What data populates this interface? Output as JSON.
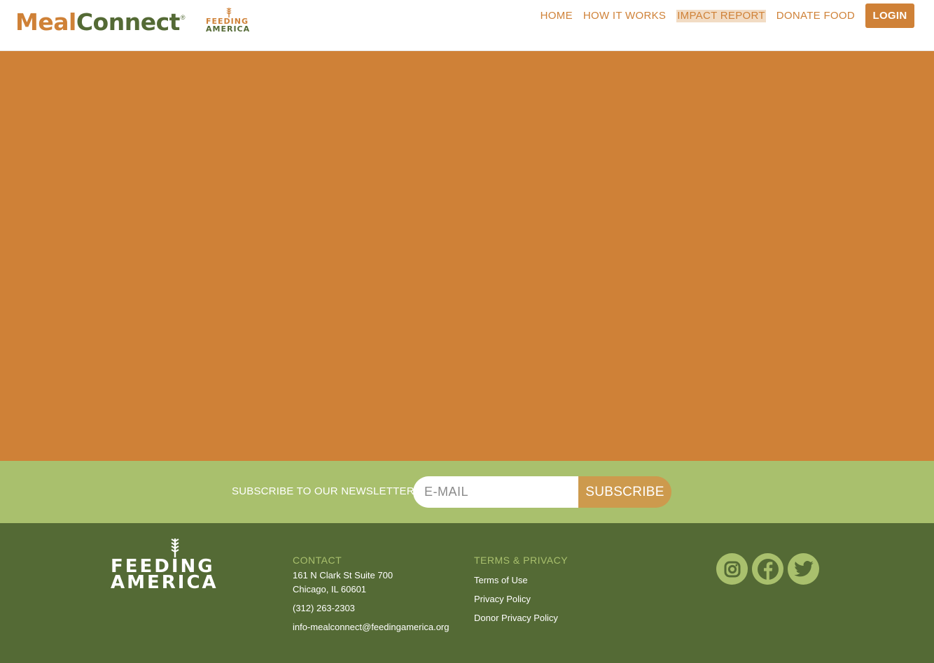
{
  "header": {
    "logo_meal": "Meal",
    "logo_connect": "Connect",
    "logo_reg": "®",
    "partner_line1": "FEEDING",
    "partner_line2": "AMERICA",
    "nav": [
      {
        "label": "HOME",
        "active": false
      },
      {
        "label": "HOW IT WORKS",
        "active": false
      },
      {
        "label": "IMPACT REPORT",
        "active": true
      },
      {
        "label": "DONATE FOOD",
        "active": false
      }
    ],
    "login_label": "LOGIN"
  },
  "newsletter": {
    "label": "SUBSCRIBE TO OUR NEWSLETTER",
    "email_placeholder": "E-MAIL",
    "subscribe_label": "SUBSCRIBE"
  },
  "footer": {
    "logo_line1": "FEEDING",
    "logo_line2": "AMERICA",
    "contact": {
      "heading": "CONTACT",
      "address1": "161 N Clark St Suite 700",
      "address2": "Chicago, IL 60601",
      "phone": "(312) 263-2303",
      "email": "info-mealconnect@feedingamerica.org"
    },
    "terms": {
      "heading": "TERMS & PRIVACY",
      "links": [
        "Terms of Use",
        "Privacy Policy",
        "Donor Privacy Policy"
      ]
    },
    "social": [
      "instagram-icon",
      "facebook-icon",
      "twitter-icon"
    ]
  },
  "colors": {
    "brand_orange": "#cf8137",
    "brand_green": "#546a35",
    "light_green": "#a9c06d",
    "subscribe_tan": "#cd9a4d"
  }
}
